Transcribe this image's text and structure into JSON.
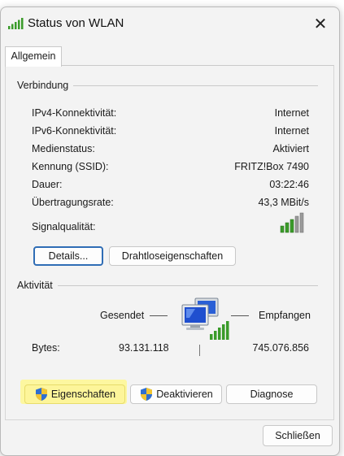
{
  "window": {
    "title": "Status von WLAN",
    "close_glyph": "✕",
    "icon": "wifi-signal-icon"
  },
  "tabs": [
    {
      "label": "Allgemein",
      "active": true
    }
  ],
  "connection": {
    "title": "Verbindung",
    "rows": [
      {
        "label": "IPv4-Konnektivität:",
        "value": "Internet"
      },
      {
        "label": "IPv6-Konnektivität:",
        "value": "Internet"
      },
      {
        "label": "Medienstatus:",
        "value": "Aktiviert"
      },
      {
        "label": "Kennung (SSID):",
        "value": "FRITZ!Box 7490"
      },
      {
        "label": "Dauer:",
        "value": "03:22:46"
      },
      {
        "label": "Übertragungsrate:",
        "value": "43,3 MBit/s"
      }
    ],
    "signal_label": "Signalqualität:",
    "signal_icon": "signal-bars-icon",
    "signal_bars": 5,
    "details_button": "Details...",
    "wireless_button": "Drahtloseigenschaften"
  },
  "activity": {
    "title": "Aktivität",
    "sent_label": "Gesendet",
    "received_label": "Empfangen",
    "bytes_label": "Bytes:",
    "bytes_sent": "93.131.118",
    "bytes_received": "745.076.856",
    "network_icon": "network-computers-icon"
  },
  "actions": {
    "properties_button": "Eigenschaften",
    "deactivate_button": "Deaktivieren",
    "diagnose_button": "Diagnose",
    "shield_icon": "uac-shield-icon"
  },
  "footer": {
    "close_button": "Schließen"
  },
  "colors": {
    "highlight": "#fdf59a",
    "focus_border": "#2f6db5",
    "signal_green": "#3a9b2a"
  }
}
